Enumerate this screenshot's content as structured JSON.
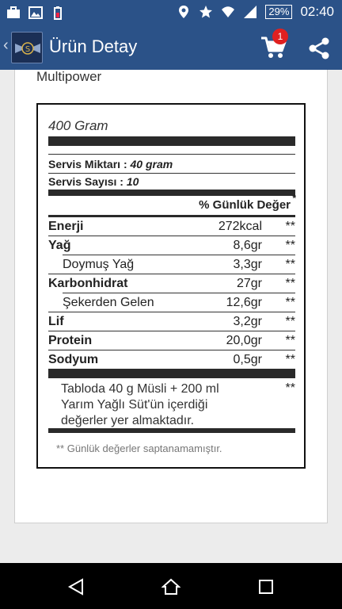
{
  "status_bar": {
    "battery": "29%",
    "time": "02:40"
  },
  "app_bar": {
    "title": "Ürün Detay",
    "cart_count": "1",
    "logo_letter": "S"
  },
  "product": {
    "brand": "Multipower"
  },
  "nutrition": {
    "package_size": "400 Gram",
    "serving_amount_label": "Servis Miktarı :",
    "serving_amount_value": "40 gram",
    "serving_count_label": "Servis Sayısı :",
    "serving_count_value": "10",
    "dv_header": "% Günlük Değer",
    "dv_header_mark": "*",
    "rows": [
      {
        "name": "Enerji",
        "value": "272kcal",
        "dv": "**"
      },
      {
        "name": "Yağ",
        "value": "8,6gr",
        "dv": "**"
      },
      {
        "name": "Doymuş Yağ",
        "value": "3,3gr",
        "dv": "**"
      },
      {
        "name": "Karbonhidrat",
        "value": "27gr",
        "dv": "**"
      },
      {
        "name": "Şekerden Gelen",
        "value": "12,6gr",
        "dv": "**"
      },
      {
        "name": "Lif",
        "value": "3,2gr",
        "dv": "**"
      },
      {
        "name": "Protein",
        "value": "20,0gr",
        "dv": "**"
      },
      {
        "name": "Sodyum",
        "value": "0,5gr",
        "dv": "**"
      }
    ],
    "note": "Tabloda 40 g Müsli + 200 ml Yarım Yağlı Süt'ün içerdiği değerler yer almaktadır.",
    "note_mark": "**",
    "footnote": "** Günlük değerler saptanamamıştır."
  },
  "colors": {
    "app_bar": "#2b5288",
    "badge": "#e02020"
  }
}
